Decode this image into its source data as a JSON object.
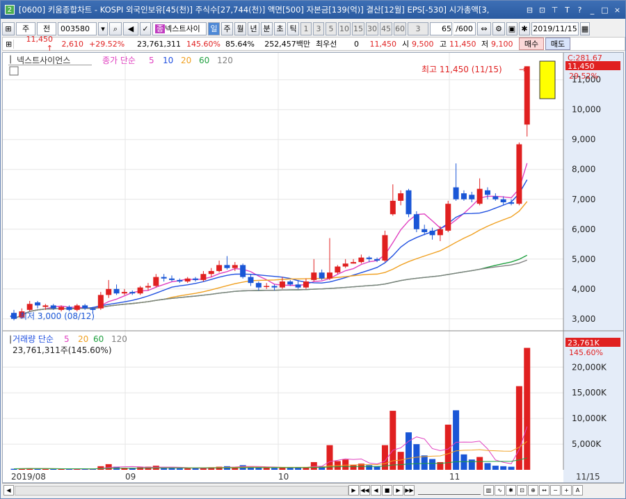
{
  "titlebar": {
    "app_icon": "2",
    "title": "[0600] 키움종합차트 - KOSPI 외국인보유[45(천)] 주식수[27,744(천)] 액면[500] 자본금[139(억)] 결산[12월] EPS[-530] 시가총액[3,",
    "buttons": [
      "⊟",
      "⊡",
      "⊤",
      "T",
      "?",
      "_",
      "□",
      "×"
    ]
  },
  "toolbar": {
    "market": "주",
    "prev": "전",
    "code": "003580",
    "stock_name": "넥스트사이",
    "periods": [
      "일",
      "주",
      "월",
      "년",
      "분",
      "초",
      "틱"
    ],
    "selected_period": "일",
    "intervals": [
      "1",
      "3",
      "5",
      "10",
      "15",
      "30",
      "45",
      "60"
    ],
    "interval_value": "3",
    "count": "65",
    "count_total": "/600",
    "date": "2019/11/15"
  },
  "quote": {
    "price": "11,450",
    "arrow": "↑",
    "change": "2,610",
    "change_pct": "+29.52%",
    "volume": "23,761,311",
    "vol_ratio": "145.60%",
    "turnover": "85.64%",
    "amount": "252,457백만",
    "preferred_label": "최우선",
    "preferred": "0",
    "ask": "11,450",
    "open_label": "시",
    "open": "9,500",
    "high_label": "고",
    "high": "11,450",
    "low_label": "저",
    "low": "9,100",
    "buy": "매수",
    "sell": "매도"
  },
  "chart": {
    "stock_label": "넥스트사이언스",
    "ma_label": "종가 단순",
    "ma_periods": [
      "5",
      "10",
      "20",
      "60",
      "120"
    ],
    "ma_colors": [
      "#e040c0",
      "#2050e0",
      "#f0a020",
      "#20a040",
      "#808080"
    ],
    "high_note": "최고 11,450 (11/15)",
    "low_note": "최저 3,000 (08/12)",
    "price_tag_top": "C:281.67",
    "price_tag": "11,450",
    "price_tag_pct": "29.52%",
    "vol_label": "거래량 단순",
    "vol_ma_periods": [
      "5",
      "20",
      "60",
      "120"
    ],
    "vol_value": "23,761,311주(145.60%)",
    "vol_tag": "23,761K",
    "vol_tag_pct": "145.60%",
    "x_labels": [
      "2019/08",
      "09",
      "10",
      "11",
      "11/15"
    ]
  },
  "chart_data": {
    "type": "candlestick",
    "price_ticks": [
      "11,000",
      "10,000",
      "9,000",
      "8,000",
      "7,000",
      "6,000",
      "5,000",
      "4,000",
      "3,000"
    ],
    "volume_ticks": [
      "20,000K",
      "15,000K",
      "10,000K",
      "5,000K"
    ],
    "ylim_price": [
      2600,
      11900
    ],
    "ylim_volume": [
      0,
      26000
    ],
    "candles": [
      {
        "o": 3200,
        "c": 3000,
        "h": 3300,
        "l": 2950,
        "v": 200
      },
      {
        "o": 3050,
        "c": 3250,
        "h": 3350,
        "l": 3000,
        "v": 250
      },
      {
        "o": 3300,
        "c": 3500,
        "h": 3600,
        "l": 3250,
        "v": 300
      },
      {
        "o": 3550,
        "c": 3450,
        "h": 3600,
        "l": 3350,
        "v": 220
      },
      {
        "o": 3400,
        "c": 3450,
        "h": 3500,
        "l": 3300,
        "v": 180
      },
      {
        "o": 3450,
        "c": 3350,
        "h": 3500,
        "l": 3300,
        "v": 170
      },
      {
        "o": 3300,
        "c": 3400,
        "h": 3450,
        "l": 3250,
        "v": 160
      },
      {
        "o": 3400,
        "c": 3300,
        "h": 3450,
        "l": 3250,
        "v": 150
      },
      {
        "o": 3300,
        "c": 3450,
        "h": 3500,
        "l": 3250,
        "v": 170
      },
      {
        "o": 3450,
        "c": 3350,
        "h": 3500,
        "l": 3300,
        "v": 160
      },
      {
        "o": 3350,
        "c": 3300,
        "h": 3400,
        "l": 3200,
        "v": 150
      },
      {
        "o": 3350,
        "c": 3800,
        "h": 3900,
        "l": 3300,
        "v": 700
      },
      {
        "o": 3800,
        "c": 4000,
        "h": 4300,
        "l": 3700,
        "v": 1100
      },
      {
        "o": 4000,
        "c": 3850,
        "h": 4150,
        "l": 3800,
        "v": 600
      },
      {
        "o": 3850,
        "c": 3900,
        "h": 4000,
        "l": 3800,
        "v": 400
      },
      {
        "o": 3900,
        "c": 3850,
        "h": 3950,
        "l": 3800,
        "v": 300
      },
      {
        "o": 3850,
        "c": 4050,
        "h": 4100,
        "l": 3800,
        "v": 500
      },
      {
        "o": 4050,
        "c": 4100,
        "h": 4200,
        "l": 3950,
        "v": 600
      },
      {
        "o": 4100,
        "c": 4400,
        "h": 4500,
        "l": 4050,
        "v": 800
      },
      {
        "o": 4400,
        "c": 4350,
        "h": 4500,
        "l": 4250,
        "v": 400
      },
      {
        "o": 4350,
        "c": 4300,
        "h": 4450,
        "l": 4250,
        "v": 350
      },
      {
        "o": 4300,
        "c": 4250,
        "h": 4350,
        "l": 4200,
        "v": 300
      },
      {
        "o": 4250,
        "c": 4350,
        "h": 4400,
        "l": 4200,
        "v": 300
      },
      {
        "o": 4350,
        "c": 4300,
        "h": 4400,
        "l": 4250,
        "v": 280
      },
      {
        "o": 4300,
        "c": 4500,
        "h": 4600,
        "l": 4250,
        "v": 400
      },
      {
        "o": 4500,
        "c": 4600,
        "h": 4700,
        "l": 4400,
        "v": 500
      },
      {
        "o": 4600,
        "c": 4800,
        "h": 4950,
        "l": 4550,
        "v": 600
      },
      {
        "o": 4800,
        "c": 4700,
        "h": 5100,
        "l": 4650,
        "v": 700
      },
      {
        "o": 4700,
        "c": 4800,
        "h": 4900,
        "l": 4600,
        "v": 500
      },
      {
        "o": 4800,
        "c": 4400,
        "h": 4850,
        "l": 4350,
        "v": 900
      },
      {
        "o": 4400,
        "c": 4200,
        "h": 4500,
        "l": 4100,
        "v": 600
      },
      {
        "o": 4200,
        "c": 4050,
        "h": 4250,
        "l": 3950,
        "v": 500
      },
      {
        "o": 4100,
        "c": 4100,
        "h": 4200,
        "l": 4000,
        "v": 400
      },
      {
        "o": 4100,
        "c": 4050,
        "h": 4150,
        "l": 3950,
        "v": 350
      },
      {
        "o": 4050,
        "c": 4250,
        "h": 4400,
        "l": 4000,
        "v": 500
      },
      {
        "o": 4250,
        "c": 4150,
        "h": 4300,
        "l": 4100,
        "v": 400
      },
      {
        "o": 4150,
        "c": 4050,
        "h": 4300,
        "l": 4000,
        "v": 450
      },
      {
        "o": 4050,
        "c": 4250,
        "h": 4350,
        "l": 4000,
        "v": 500
      },
      {
        "o": 4300,
        "c": 4550,
        "h": 5000,
        "l": 4250,
        "v": 1500
      },
      {
        "o": 4550,
        "c": 4350,
        "h": 4650,
        "l": 4300,
        "v": 700
      },
      {
        "o": 4350,
        "c": 4550,
        "h": 5700,
        "l": 4300,
        "v": 4800
      },
      {
        "o": 4550,
        "c": 4750,
        "h": 4800,
        "l": 4500,
        "v": 1700
      },
      {
        "o": 4750,
        "c": 4850,
        "h": 5000,
        "l": 4700,
        "v": 2000
      },
      {
        "o": 4850,
        "c": 4900,
        "h": 5000,
        "l": 4850,
        "v": 900
      },
      {
        "o": 4900,
        "c": 5050,
        "h": 5150,
        "l": 4850,
        "v": 1200
      },
      {
        "o": 5050,
        "c": 5000,
        "h": 5100,
        "l": 4900,
        "v": 900
      },
      {
        "o": 5000,
        "c": 4950,
        "h": 5050,
        "l": 4900,
        "v": 700
      },
      {
        "o": 4950,
        "c": 5800,
        "h": 5950,
        "l": 4900,
        "v": 4800
      },
      {
        "o": 6500,
        "c": 6950,
        "h": 7500,
        "l": 6450,
        "v": 11500
      },
      {
        "o": 6950,
        "c": 7200,
        "h": 7300,
        "l": 6800,
        "v": 3500
      },
      {
        "o": 7300,
        "c": 6500,
        "h": 7350,
        "l": 6400,
        "v": 7300
      },
      {
        "o": 6500,
        "c": 6000,
        "h": 6600,
        "l": 5900,
        "v": 5000
      },
      {
        "o": 6000,
        "c": 5900,
        "h": 6150,
        "l": 5800,
        "v": 2800
      },
      {
        "o": 5950,
        "c": 5800,
        "h": 6050,
        "l": 5650,
        "v": 2100
      },
      {
        "o": 5800,
        "c": 6000,
        "h": 6100,
        "l": 5600,
        "v": 1500
      },
      {
        "o": 5950,
        "c": 6850,
        "h": 6950,
        "l": 5900,
        "v": 8800
      },
      {
        "o": 7400,
        "c": 7000,
        "h": 8200,
        "l": 6950,
        "v": 11600
      },
      {
        "o": 7200,
        "c": 7000,
        "h": 7300,
        "l": 6950,
        "v": 3000
      },
      {
        "o": 7150,
        "c": 7000,
        "h": 7250,
        "l": 6900,
        "v": 2000
      },
      {
        "o": 6850,
        "c": 7350,
        "h": 7700,
        "l": 6800,
        "v": 2500
      },
      {
        "o": 7300,
        "c": 7150,
        "h": 7400,
        "l": 7000,
        "v": 1300
      },
      {
        "o": 7100,
        "c": 7000,
        "h": 7200,
        "l": 6950,
        "v": 800
      },
      {
        "o": 7000,
        "c": 6900,
        "h": 7100,
        "l": 6800,
        "v": 700
      },
      {
        "o": 6900,
        "c": 6850,
        "h": 7000,
        "l": 6800,
        "v": 600
      },
      {
        "o": 6850,
        "c": 8840,
        "h": 8900,
        "l": 6800,
        "v": 16300
      },
      {
        "o": 9500,
        "c": 11450,
        "h": 11450,
        "l": 9100,
        "v": 23761
      }
    ]
  }
}
